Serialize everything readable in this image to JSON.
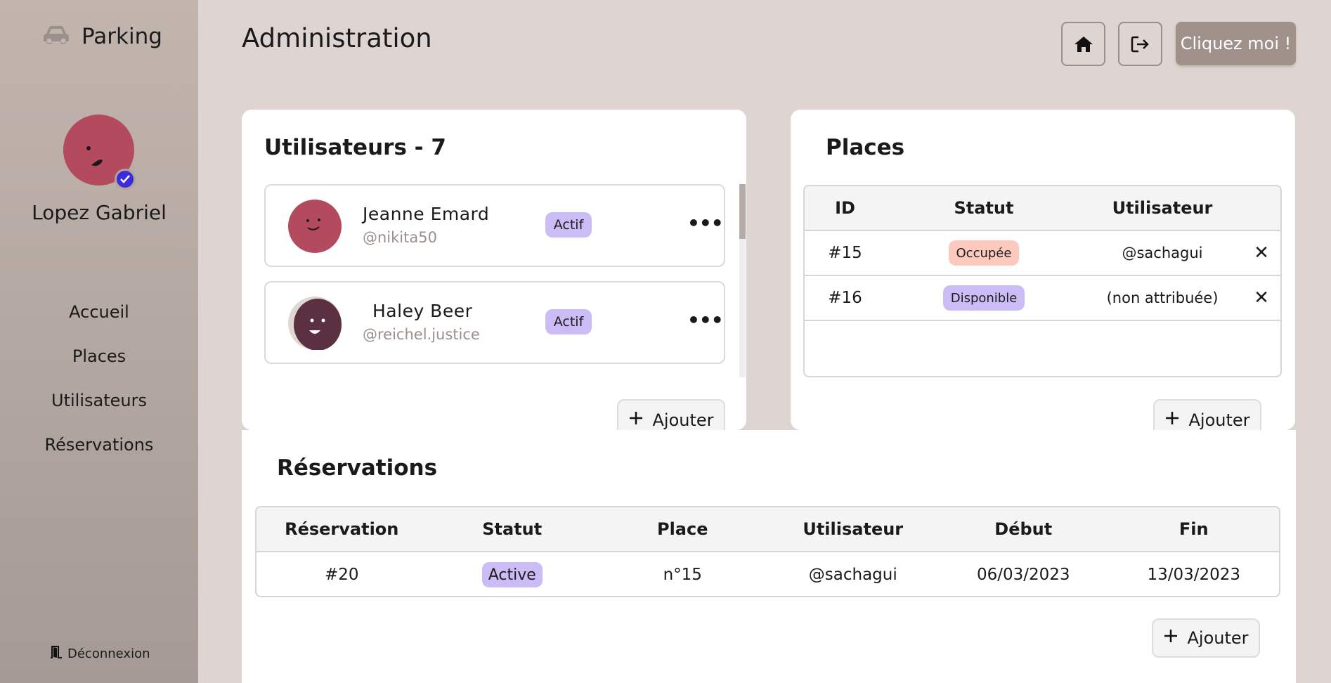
{
  "app": {
    "name": "Parking"
  },
  "user": {
    "name": "Lopez Gabriel"
  },
  "nav": {
    "items": [
      "Accueil",
      "Places",
      "Utilisateurs",
      "Réservations"
    ],
    "logout": "Déconnexion"
  },
  "header": {
    "title": "Administration",
    "cta": "Cliquez moi !"
  },
  "users": {
    "title": "Utilisateurs - 7",
    "list": [
      {
        "name": "Jeanne  Emard",
        "handle": "@nikita50",
        "status": "Actif"
      },
      {
        "name": "Haley  Beer",
        "handle": "@reichel.justice",
        "status": "Actif"
      }
    ],
    "add": "Ajouter"
  },
  "places": {
    "title": "Places",
    "columns": [
      "ID",
      "Statut",
      "Utilisateur"
    ],
    "rows": [
      {
        "id": "#15",
        "status": "Occupée",
        "user": "@sachagui"
      },
      {
        "id": "#16",
        "status": "Disponible",
        "user": "(non attribuée)"
      }
    ],
    "add": "Ajouter"
  },
  "reservations": {
    "title": "Réservations",
    "columns": [
      "Réservation",
      "Statut",
      "Place",
      "Utilisateur",
      "Début",
      "Fin"
    ],
    "rows": [
      {
        "id": "#20",
        "status": "Active",
        "place": "n°15",
        "user": "@sachagui",
        "start": "06/03/2023",
        "end": "13/03/2023"
      }
    ],
    "add": "Ajouter"
  },
  "colors": {
    "accent": "#3b2bd8",
    "badge": "#cbbcf5",
    "occupied": "#fcc9bf",
    "avatar": "#b44a5e"
  }
}
